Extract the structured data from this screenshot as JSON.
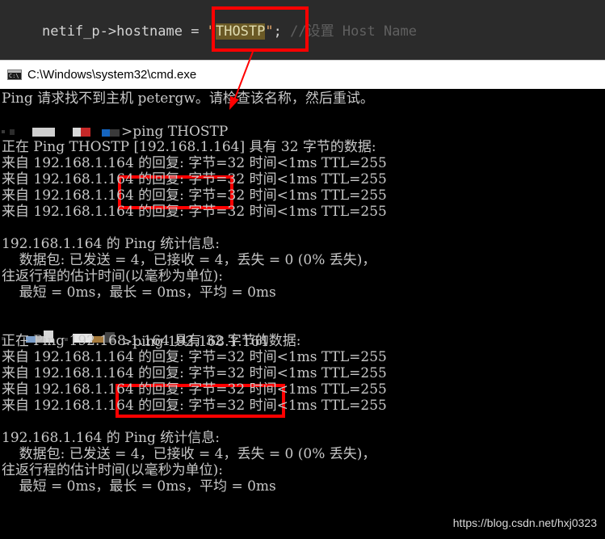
{
  "code": {
    "ident": "netif_p->hostname",
    "op": " = ",
    "quote_open": "\"",
    "string_value": "THOSTP",
    "quote_close": "\"",
    "semicolon": ";",
    "comment": " //设置 Host Name"
  },
  "window": {
    "title": "C:\\Windows\\system32\\cmd.exe",
    "icon": "cmd-icon",
    "icon_glyph": "C:\\"
  },
  "console": {
    "lines": [
      "Ping 请求找不到主机 petergw。请检查该名称，然后重试。",
      "",
      "",
      "正在 Ping THOSTP [192.168.1.164] 具有 32 字节的数据:",
      "来自 192.168.1.164 的回复: 字节=32 时间<1ms TTL=255",
      "来自 192.168.1.164 的回复: 字节=32 时间<1ms TTL=255",
      "来自 192.168.1.164 的回复: 字节=32 时间<1ms TTL=255",
      "来自 192.168.1.164 的回复: 字节=32 时间<1ms TTL=255",
      "",
      "192.168.1.164 的 Ping 统计信息:",
      "    数据包: 已发送 = 4，已接收 = 4，丢失 = 0 (0% 丢失)，",
      "往返行程的估计时间(以毫秒为单位):",
      "    最短 = 0ms，最长 = 0ms，平均 = 0ms",
      "",
      "",
      "正在 Ping 192.168.1.164 具有 32 字节的数据:",
      "来自 192.168.1.164 的回复: 字节=32 时间<1ms TTL=255",
      "来自 192.168.1.164 的回复: 字节=32 时间<1ms TTL=255",
      "来自 192.168.1.164 的回复: 字节=32 时间<1ms TTL=255",
      "来自 192.168.1.164 的回复: 字节=32 时间<1ms TTL=255",
      "",
      "192.168.1.164 的 Ping 统计信息:",
      "    数据包: 已发送 = 4，已接收 = 4，丢失 = 0 (0% 丢失)，",
      "往返行程的估计时间(以毫秒为单位):",
      "    最短 = 0ms，最长 = 0ms，平均 = 0ms"
    ],
    "prompt1_command": ">ping THOSTP",
    "prompt2_command": ">ping 192.168.1.164"
  },
  "watermark": "https://blog.csdn.net/hxj0323",
  "colors": {
    "highlight_box": "#ff0000",
    "arrow": "#ff0000",
    "console_bg": "#000000",
    "console_text": "#c8c8c8",
    "code_bg": "#2b2b2b"
  }
}
